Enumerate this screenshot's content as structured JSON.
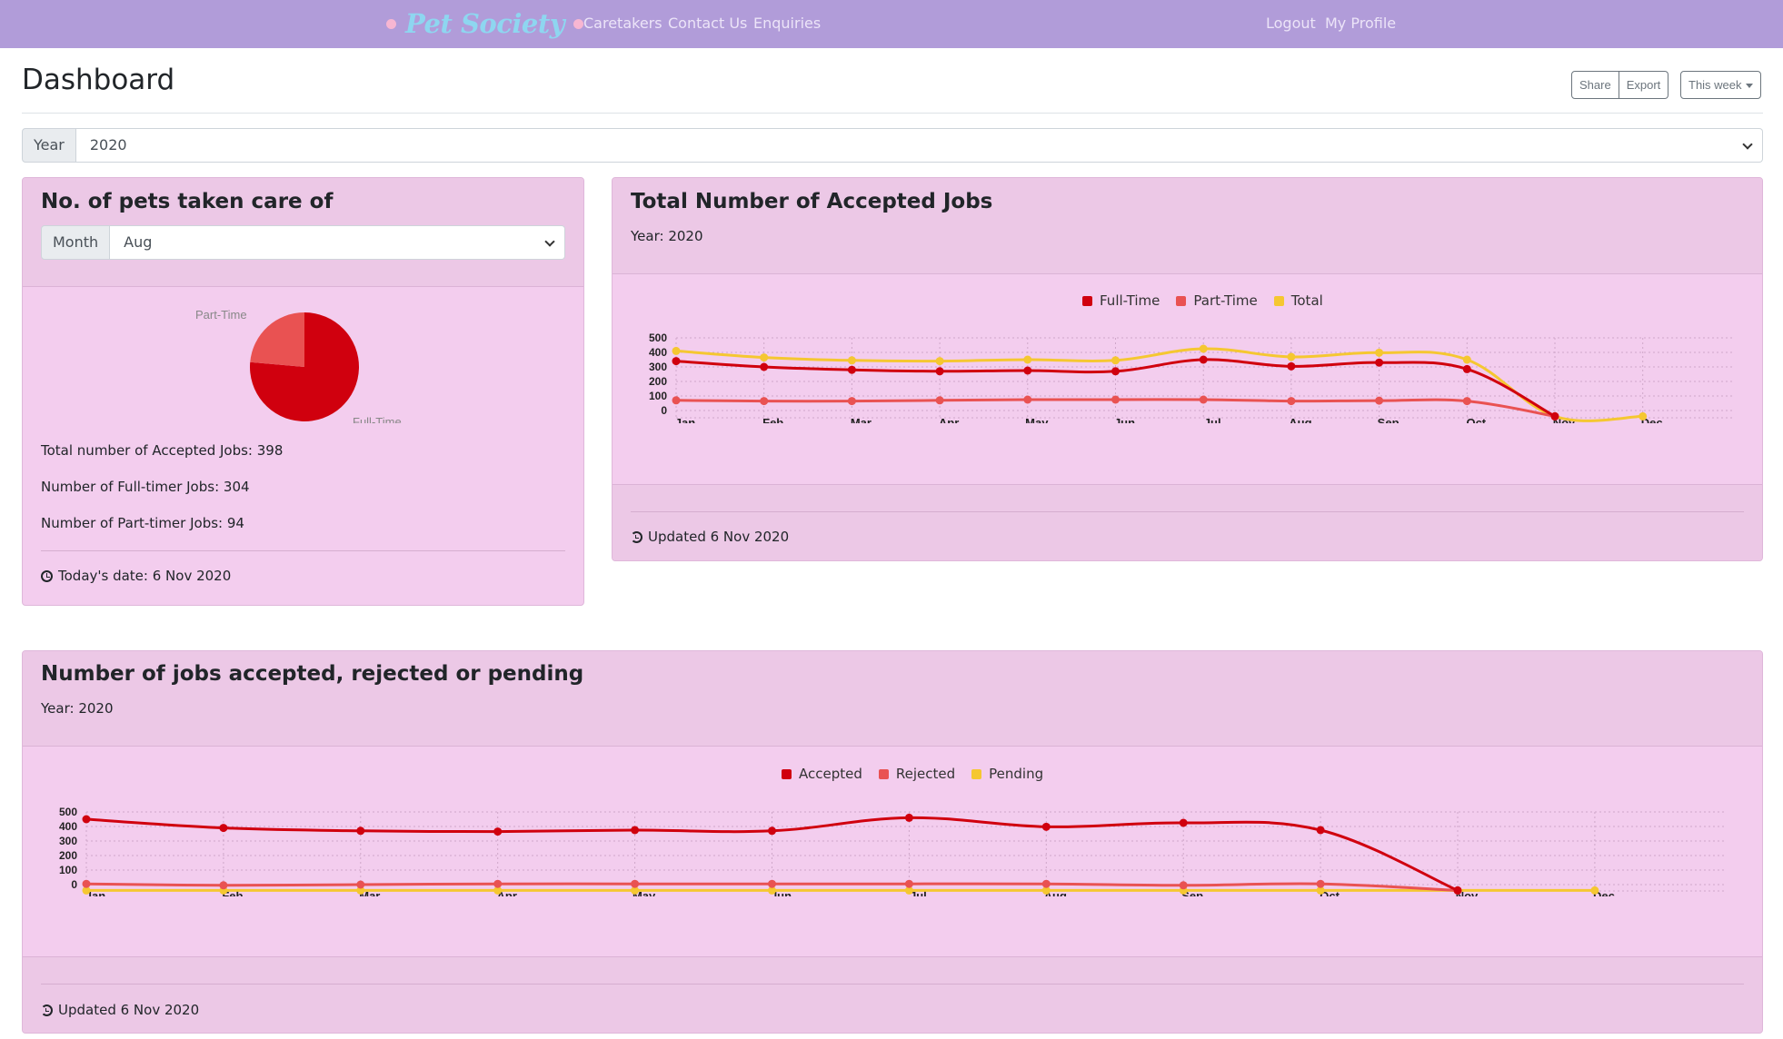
{
  "navbar": {
    "brand": "Pet Society",
    "links": [
      "Caretakers",
      "Contact Us",
      "Enquiries"
    ],
    "right_links": [
      "Logout",
      "My Profile"
    ]
  },
  "header": {
    "title": "Dashboard",
    "share_label": "Share",
    "export_label": "Export",
    "range_label": "This week"
  },
  "year_filter": {
    "label": "Year",
    "value": "2020"
  },
  "pets_card": {
    "title": "No. of pets taken care of",
    "month_label": "Month",
    "month_value": "Aug",
    "pie_labels": {
      "part_time": "Part-Time",
      "full_time": "Full-Time"
    },
    "total_line": "Total number of Accepted Jobs: 398",
    "full_line": "Number of Full-timer Jobs: 304",
    "part_line": "Number of Part-timer Jobs: 94",
    "footer": "Today's date: 6 Nov 2020"
  },
  "accepted_card": {
    "title": "Total Number of Accepted Jobs",
    "subtitle": "Year: 2020",
    "footer": "Updated 6 Nov 2020"
  },
  "status_card": {
    "title": "Number of jobs accepted, rejected or pending",
    "subtitle": "Year: 2020",
    "footer": "Updated 6 Nov 2020"
  },
  "colors": {
    "navbar": "#b19cd9",
    "card_bg": "#f3cdee",
    "dark_red": "#d0000e",
    "light_red": "#e95252",
    "yellow": "#f5c731"
  },
  "chart_data": [
    {
      "type": "pie",
      "labels": [
        "Full-Time",
        "Part-Time"
      ],
      "values": [
        304,
        94
      ],
      "colors": [
        "#d0000e",
        "#e95252"
      ]
    },
    {
      "type": "line",
      "categories": [
        "Jan",
        "Feb",
        "Mar",
        "Apr",
        "May",
        "Jun",
        "Jul",
        "Aug",
        "Sep",
        "Oct",
        "Nov",
        "Dec"
      ],
      "yticks": [
        0,
        100,
        200,
        300,
        400,
        500
      ],
      "ylim": [
        0,
        500
      ],
      "grid": true,
      "legend": "top-center",
      "series": [
        {
          "name": "Full-Time",
          "color": "#d0000e",
          "values": [
            340,
            300,
            280,
            270,
            275,
            270,
            350,
            304,
            330,
            285,
            -40,
            null
          ]
        },
        {
          "name": "Part-Time",
          "color": "#e95252",
          "values": [
            70,
            65,
            65,
            70,
            75,
            75,
            75,
            65,
            68,
            65,
            -40,
            null
          ]
        },
        {
          "name": "Total",
          "color": "#f5c731",
          "values": [
            410,
            365,
            345,
            340,
            350,
            345,
            425,
            369,
            398,
            350,
            -40,
            -40
          ]
        }
      ]
    },
    {
      "type": "line",
      "categories": [
        "Jan",
        "Feb",
        "Mar",
        "Apr",
        "May",
        "Jun",
        "Jul",
        "Aug",
        "Sep",
        "Oct",
        "Nov",
        "Dec"
      ],
      "yticks": [
        0,
        100,
        200,
        300,
        400,
        500
      ],
      "ylim": [
        0,
        500
      ],
      "grid": true,
      "legend": "top-center",
      "series": [
        {
          "name": "Accepted",
          "color": "#d0000e",
          "values": [
            450,
            390,
            370,
            365,
            375,
            370,
            460,
            398,
            425,
            375,
            -40,
            null
          ]
        },
        {
          "name": "Rejected",
          "color": "#e95252",
          "values": [
            5,
            -5,
            0,
            5,
            5,
            5,
            5,
            5,
            -5,
            5,
            -40,
            null
          ]
        },
        {
          "name": "Pending",
          "color": "#f5c731",
          "values": [
            -40,
            -40,
            -40,
            -40,
            -40,
            -40,
            -40,
            -40,
            -40,
            -40,
            -40,
            -40
          ]
        }
      ]
    }
  ]
}
